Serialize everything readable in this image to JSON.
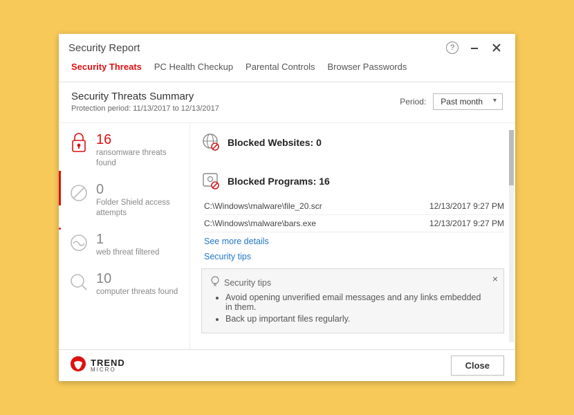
{
  "window": {
    "title": "Security Report"
  },
  "tabs": [
    "Security Threats",
    "PC Health Checkup",
    "Parental Controls",
    "Browser Passwords"
  ],
  "summary": {
    "title": "Security Threats Summary",
    "sub": "Protection period: 11/13/2017 to 12/13/2017",
    "period_label": "Period:",
    "period_value": "Past month"
  },
  "stats": [
    {
      "count": "16",
      "label": "ransomware threats found"
    },
    {
      "count": "0",
      "label": "Folder Shield access attempts"
    },
    {
      "count": "1",
      "label": "web threat filtered"
    },
    {
      "count": "10",
      "label": "computer threats found"
    }
  ],
  "blocked_sites": {
    "title": "Blocked Websites: 0"
  },
  "blocked_programs": {
    "title": "Blocked Programs: 16",
    "rows": [
      {
        "path": "C:\\Windows\\malware\\file_20.scr",
        "time": "12/13/2017 9:27 PM"
      },
      {
        "path": "C:\\Windows\\malware\\bars.exe",
        "time": "12/13/2017 9:27 PM"
      }
    ],
    "see_more": "See more details",
    "tips_link": "Security tips"
  },
  "tips": {
    "heading": "Security tips",
    "items": [
      "Avoid opening unverified email messages and any links embedded in them.",
      "Back up important files regularly."
    ]
  },
  "brand": {
    "line1": "TREND",
    "line2": "MICRO"
  },
  "footer": {
    "close": "Close"
  }
}
